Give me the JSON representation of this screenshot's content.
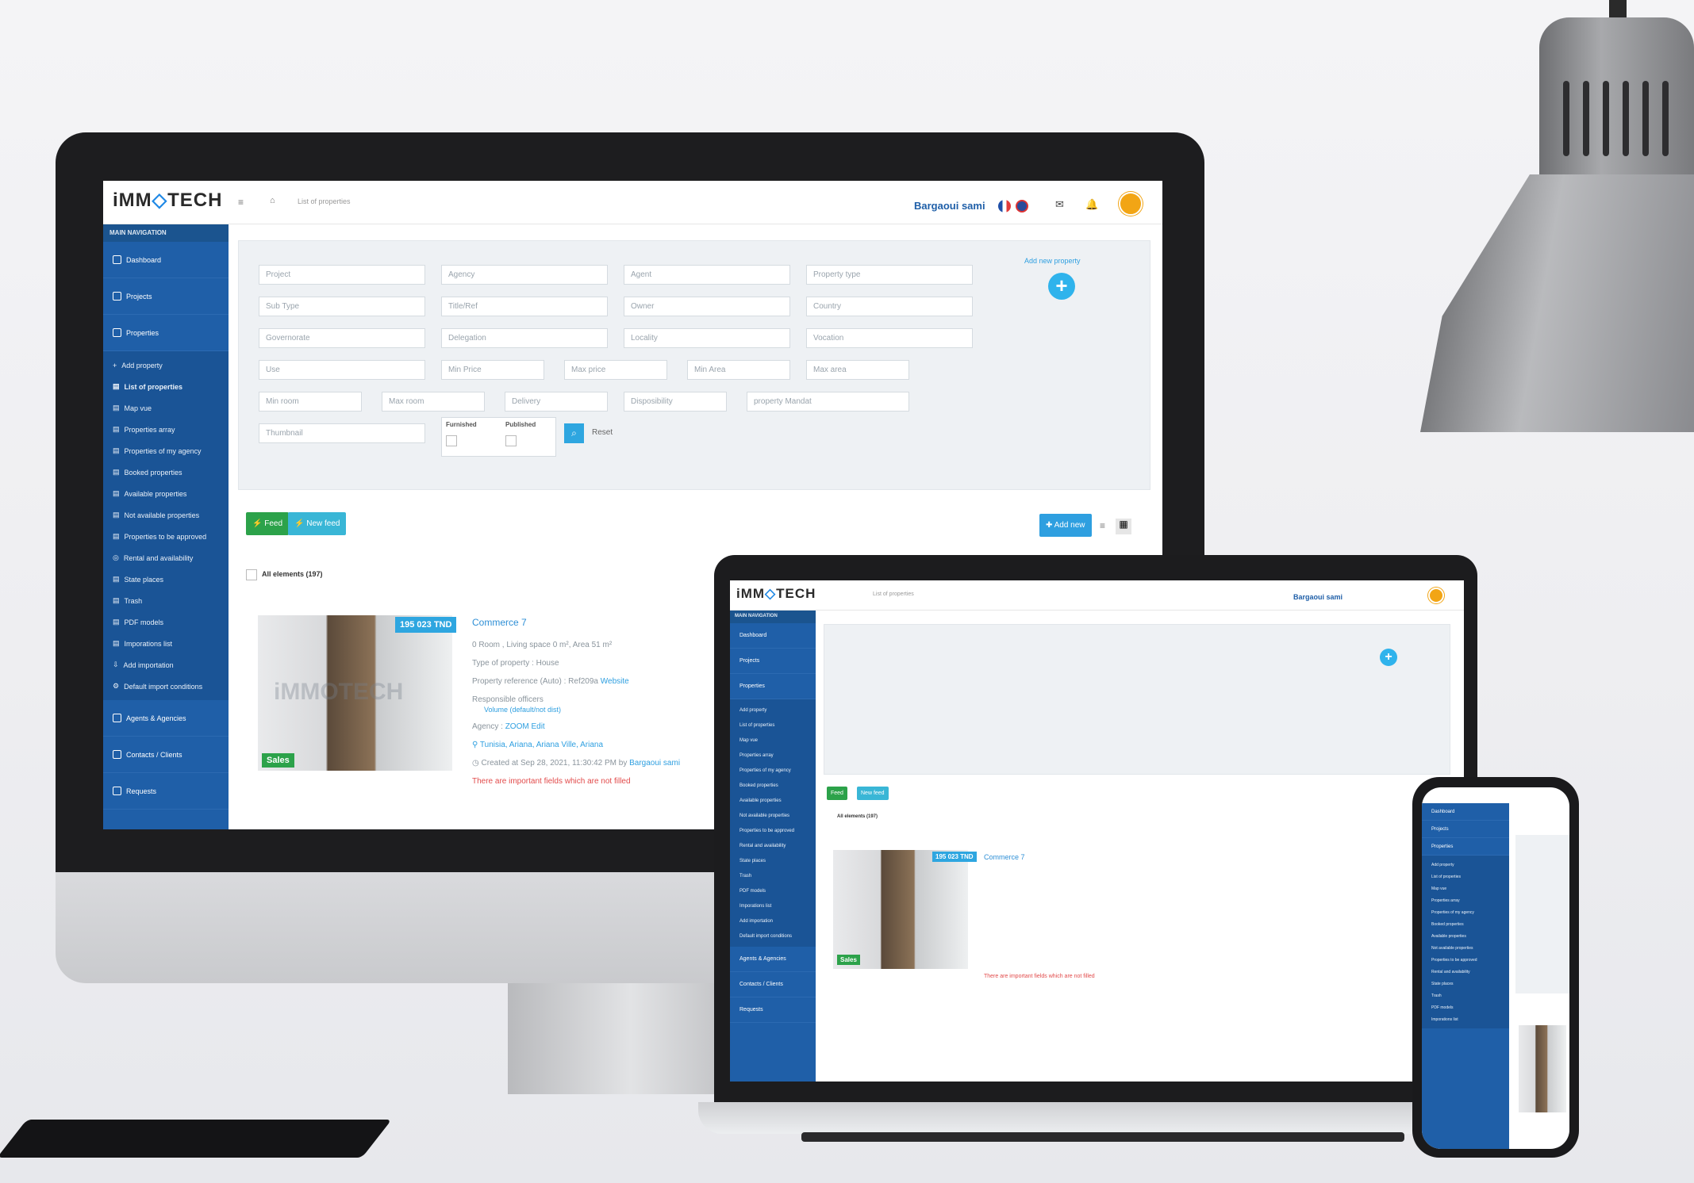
{
  "brand": {
    "logo_left": "iMM",
    "logo_mark": "◇",
    "logo_right": "TECH"
  },
  "topbar": {
    "breadcrumb": "List of properties",
    "user_name": "Bargaoui sami"
  },
  "sidebar": {
    "header": "MAIN NAVIGATION",
    "dashboard": "Dashboard",
    "projects": "Projects",
    "properties": "Properties",
    "sub": [
      "Add property",
      "List of properties",
      "Map vue",
      "Properties array",
      "Properties of my agency",
      "Booked properties",
      "Available properties",
      "Not available properties",
      "Properties to be approved",
      "Rental and availability",
      "State places",
      "Trash",
      "PDF models",
      "Imporations list",
      "Add importation",
      "Default import conditions"
    ],
    "agents": "Agents & Agencies",
    "contacts": "Contacts / Clients",
    "requests": "Requests"
  },
  "filters": {
    "row1": [
      "Project",
      "Agency",
      "Agent",
      "Property type"
    ],
    "row2": [
      "Sub Type",
      "Title/Ref",
      "Owner",
      "Country"
    ],
    "row3": [
      "Governorate",
      "Delegation",
      "Locality",
      "Vocation"
    ],
    "row4": [
      "Use",
      "Min Price",
      "Max price",
      "Min Area",
      "Max area"
    ],
    "row5": [
      "Min room",
      "Max room",
      "Delivery",
      "Disposibility",
      "property Mandat"
    ],
    "row6": [
      "Thumbnail"
    ],
    "furnished": "Furnished",
    "published": "Published",
    "reset": "Reset",
    "add_new_property": "Add new property"
  },
  "actions": {
    "feed": "Feed",
    "new_feed": "New feed",
    "add_new": "Add new",
    "all_elements": "All elements (197)"
  },
  "property": {
    "title": "Commerce 7",
    "price": "195 023 TND",
    "tag": "Sales",
    "watermark": "iMMOTECH",
    "l1": "0 Room , Living space 0 m², Area 51 m²",
    "l2": "Type of property : House",
    "l3_label": "Property reference (Auto) : Ref209a ",
    "l3_link": "Website",
    "l4": "Responsible officers",
    "l5": "Volume (default/not dist)",
    "l6_label": "Agency : ",
    "l6_link": "ZOOM Edit",
    "l7": "Tunisia, Ariana, Ariana Ville, Ariana",
    "l8_label": "Created at Sep 28, 2021, 11:30:42 PM by ",
    "l8_link": "Bargaoui sami",
    "warn": "There are important fields which are not filled"
  },
  "colors": {
    "sidebar": "#1f5fa8",
    "accent": "#2e9fe0",
    "green": "#2ca24a",
    "avatar": "#f2a515"
  }
}
